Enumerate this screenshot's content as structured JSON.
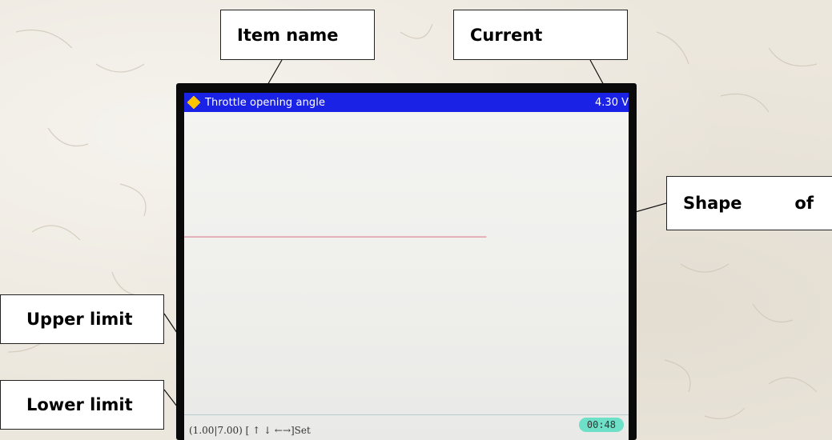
{
  "callouts": {
    "item_name": "Item name",
    "current": "Current",
    "shape_word": "Shape",
    "shape_of": "of",
    "upper_limit": "Upper limit",
    "lower_limit": "Lower limit"
  },
  "screen": {
    "title": "Throttle opening angle",
    "current_value": "4.30 V",
    "lower_limit": "1.00",
    "upper_limit": "7.00",
    "controls_text": "(1.00|7.00) [ ↑ ↓ ←→]Set",
    "timer": "00:48"
  },
  "colors": {
    "title_bar": "#1a22e6",
    "waveform": "#d98a96",
    "timer_badge": "#6fe0c8",
    "diamond": "#ffc400"
  },
  "icons": {
    "title_marker": "diamond-icon"
  },
  "chart_data": {
    "type": "line",
    "title": "Throttle opening angle",
    "series": [
      {
        "values": [
          4.3,
          4.3
        ]
      }
    ],
    "ylim": [
      1.0,
      7.0
    ],
    "current_reading": 4.3
  }
}
